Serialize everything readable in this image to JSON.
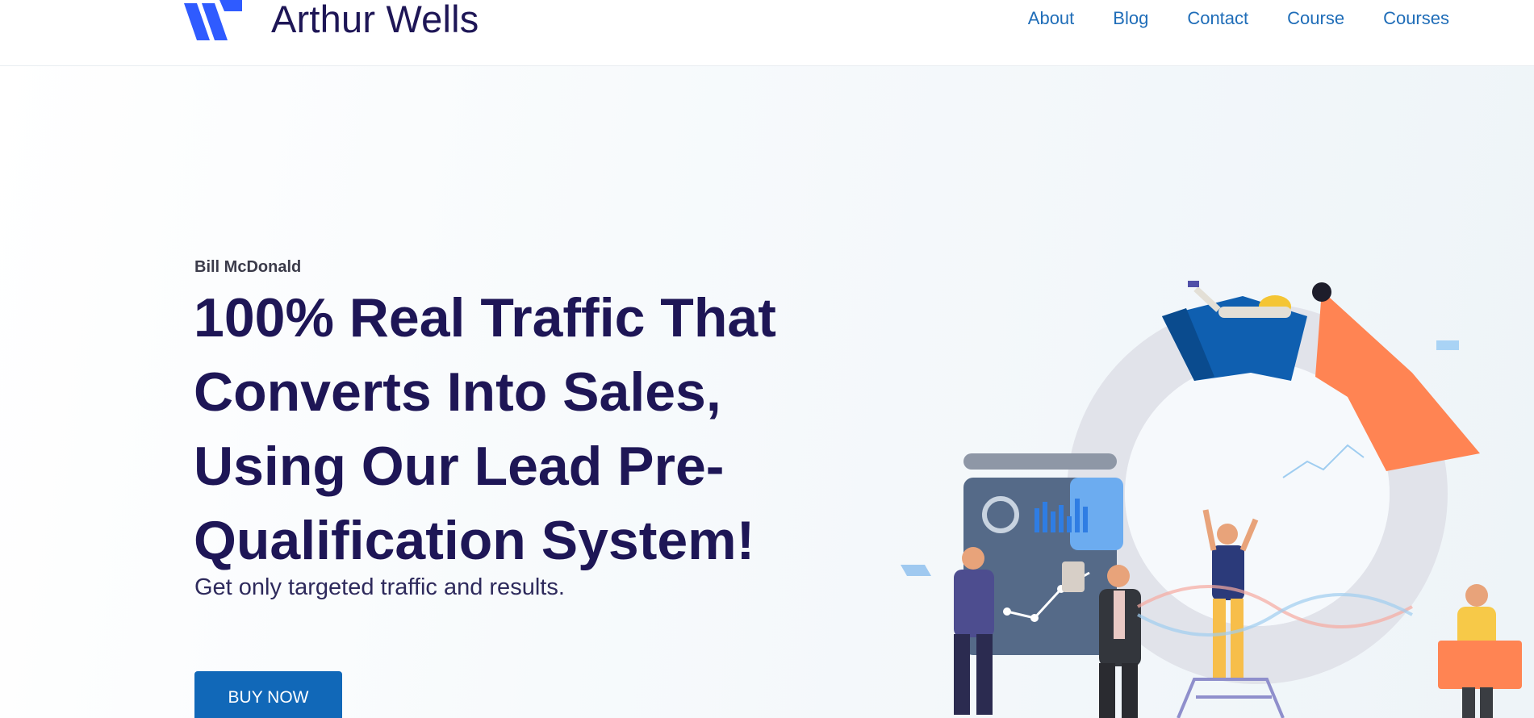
{
  "header": {
    "brand": "Arthur Wells",
    "nav": [
      "About",
      "Blog",
      "Contact",
      "Course",
      "Courses"
    ]
  },
  "hero": {
    "eyebrow": "Bill McDonald",
    "headline": "100% Real Traffic That Converts Into Sales, Using Our Lead Pre-Qualification System!",
    "subheadline": "Get only targeted traffic and results.",
    "cta_label": "BUY NOW"
  },
  "colors": {
    "brand_dark": "#1e1656",
    "nav_link": "#1f6db8",
    "button": "#1168b8",
    "logo_blue": "#2f5bff",
    "accent_orange": "#ff8453"
  },
  "icons": [
    "logo-mark-icon",
    "analytics-team-illustration"
  ]
}
